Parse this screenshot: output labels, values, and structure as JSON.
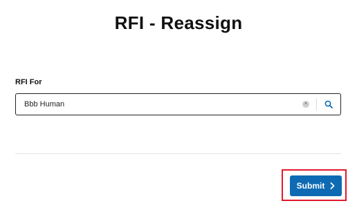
{
  "header": {
    "title": "RFI - Reassign"
  },
  "form": {
    "rfi_for_label": "RFI For",
    "rfi_for_value": "Bbb Human",
    "clear_glyph": "×",
    "search_icon": "magnifier-icon"
  },
  "actions": {
    "submit_label": "Submit",
    "submit_icon": "chevron-right-icon",
    "submit_color": "#0e6bb3",
    "highlight_color": "#e0192b"
  }
}
